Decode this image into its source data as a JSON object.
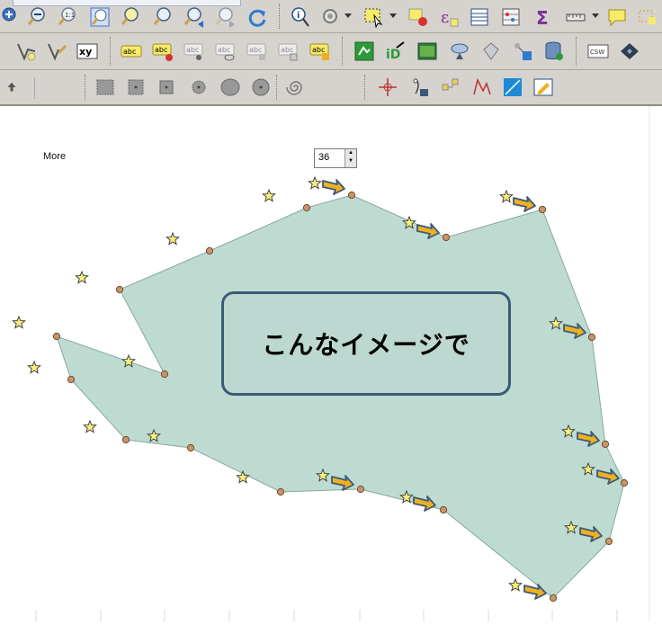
{
  "toolbar3": {
    "more_label": "More",
    "spin_value": "36"
  },
  "map": {
    "callout_text": "こんなイメージで",
    "polygon_fill": "#bedbd2",
    "vertex_color": "#c8956a",
    "star_color": "#f5f07a",
    "arrow_color": "#f0b020",
    "arrow_outline": "#3b5a78"
  },
  "icons": {
    "row1": [
      "zoom-full-icon",
      "zoom-out-icon",
      "zoom-native-icon",
      "zoom-layer-icon",
      "zoom-selection-icon",
      "zoom-last-icon",
      "zoom-prev-icon",
      "zoom-next-icon",
      "refresh-icon",
      "identify-icon",
      "action-icon",
      "select-feature-icon",
      "deselect-icon",
      "expression-select-icon",
      "attribute-table-icon",
      "statistics-icon",
      "sum-icon",
      "measure-icon",
      "annotation-icon",
      "tip-icon"
    ],
    "row2": [
      "add-vector-feature-icon",
      "digitize-icon",
      "xy-csv-icon",
      "label-abc-icon",
      "label-pin-icon",
      "label-move-icon",
      "label-show-icon",
      "label-rotate-icon",
      "label-change-icon",
      "label-highlight-icon",
      "grass-tool-icon",
      "osm-icon",
      "raster-icon",
      "wfs-icon",
      "wms-icon",
      "processing-icon",
      "database-icon",
      "csw-icon",
      "gps-icon"
    ],
    "row3": [
      "upload-icon",
      "rect-select-icon",
      "rect-center-icon",
      "square-icon",
      "circle-point-icon",
      "ellipse-icon",
      "circle-dot-icon",
      "spiral-icon",
      "crosshair-icon",
      "digitizer-icon",
      "node-icon",
      "vertex-tool-icon",
      "georef-icon",
      "edit-icon"
    ]
  }
}
